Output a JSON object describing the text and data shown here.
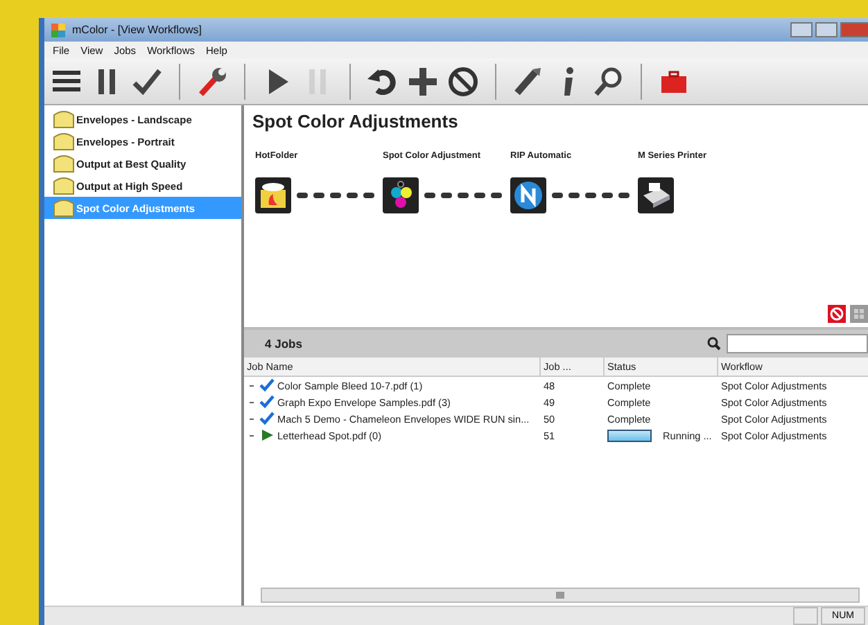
{
  "window": {
    "title": "mColor - [View Workflows]"
  },
  "menu": [
    "File",
    "View",
    "Jobs",
    "Workflows",
    "Help"
  ],
  "toolbar": [
    [
      {
        "kind": "list",
        "disabled": false
      },
      {
        "kind": "pause",
        "disabled": false
      },
      {
        "kind": "check",
        "disabled": false
      }
    ],
    [
      {
        "kind": "wrench",
        "disabled": false
      }
    ],
    [
      {
        "kind": "play",
        "disabled": false
      },
      {
        "kind": "pause",
        "disabled": true
      }
    ],
    [
      {
        "kind": "undo",
        "disabled": false
      },
      {
        "kind": "plus",
        "disabled": false
      },
      {
        "kind": "cancel",
        "disabled": false
      }
    ],
    [
      {
        "kind": "pen",
        "disabled": false
      },
      {
        "kind": "info",
        "disabled": false
      },
      {
        "kind": "search",
        "disabled": false
      }
    ],
    [
      {
        "kind": "toolbox",
        "disabled": false
      }
    ]
  ],
  "sidebar": {
    "items": [
      {
        "label": "Envelopes - Landscape",
        "selected": false
      },
      {
        "label": "Envelopes - Portrait",
        "selected": false
      },
      {
        "label": "Output at Best Quality",
        "selected": false
      },
      {
        "label": "Output at High Speed",
        "selected": false
      },
      {
        "label": "Spot Color Adjustments",
        "selected": true
      }
    ]
  },
  "workflow": {
    "title": "Spot Color Adjustments",
    "nodes": [
      {
        "label": "HotFolder",
        "kind": "hotfolder"
      },
      {
        "label": "Spot Color Adjustment",
        "kind": "spot"
      },
      {
        "label": "RIP Automatic",
        "kind": "rip"
      },
      {
        "label": "M Series Printer",
        "kind": "printer"
      }
    ]
  },
  "jobs": {
    "title": "4 Jobs",
    "columns": [
      "Job Name",
      "Job ...",
      "Status",
      "Workflow"
    ],
    "rows": [
      {
        "name": "Color Sample Bleed 10-7.pdf (1)",
        "kind": "complete",
        "number": "48",
        "status": "Complete",
        "workflow": "Spot Color Adjustments"
      },
      {
        "name": "Graph Expo Envelope Samples.pdf (3)",
        "kind": "complete",
        "number": "49",
        "status": "Complete",
        "workflow": "Spot Color Adjustments"
      },
      {
        "name": "Mach 5 Demo - Chameleon Envelopes WIDE RUN sin...",
        "kind": "complete",
        "number": "50",
        "status": "Complete",
        "workflow": "Spot Color Adjustments"
      },
      {
        "name": "Letterhead Spot.pdf (0)",
        "kind": "running",
        "number": "51",
        "status": "Running ...",
        "level": 1,
        "workflow": "Spot Color Adjustments"
      }
    ]
  },
  "status_bar": {
    "indicator": "NUM"
  }
}
